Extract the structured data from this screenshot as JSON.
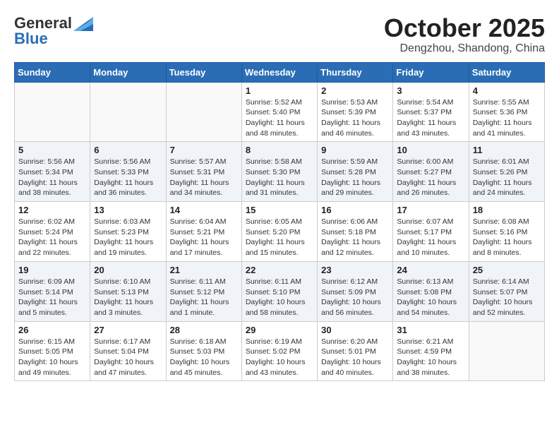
{
  "header": {
    "logo_general": "General",
    "logo_blue": "Blue",
    "month_title": "October 2025",
    "location": "Dengzhou, Shandong, China"
  },
  "weekdays": [
    "Sunday",
    "Monday",
    "Tuesday",
    "Wednesday",
    "Thursday",
    "Friday",
    "Saturday"
  ],
  "weeks": [
    [
      {
        "day": "",
        "info": ""
      },
      {
        "day": "",
        "info": ""
      },
      {
        "day": "",
        "info": ""
      },
      {
        "day": "1",
        "info": "Sunrise: 5:52 AM\nSunset: 5:40 PM\nDaylight: 11 hours\nand 48 minutes."
      },
      {
        "day": "2",
        "info": "Sunrise: 5:53 AM\nSunset: 5:39 PM\nDaylight: 11 hours\nand 46 minutes."
      },
      {
        "day": "3",
        "info": "Sunrise: 5:54 AM\nSunset: 5:37 PM\nDaylight: 11 hours\nand 43 minutes."
      },
      {
        "day": "4",
        "info": "Sunrise: 5:55 AM\nSunset: 5:36 PM\nDaylight: 11 hours\nand 41 minutes."
      }
    ],
    [
      {
        "day": "5",
        "info": "Sunrise: 5:56 AM\nSunset: 5:34 PM\nDaylight: 11 hours\nand 38 minutes."
      },
      {
        "day": "6",
        "info": "Sunrise: 5:56 AM\nSunset: 5:33 PM\nDaylight: 11 hours\nand 36 minutes."
      },
      {
        "day": "7",
        "info": "Sunrise: 5:57 AM\nSunset: 5:31 PM\nDaylight: 11 hours\nand 34 minutes."
      },
      {
        "day": "8",
        "info": "Sunrise: 5:58 AM\nSunset: 5:30 PM\nDaylight: 11 hours\nand 31 minutes."
      },
      {
        "day": "9",
        "info": "Sunrise: 5:59 AM\nSunset: 5:28 PM\nDaylight: 11 hours\nand 29 minutes."
      },
      {
        "day": "10",
        "info": "Sunrise: 6:00 AM\nSunset: 5:27 PM\nDaylight: 11 hours\nand 26 minutes."
      },
      {
        "day": "11",
        "info": "Sunrise: 6:01 AM\nSunset: 5:26 PM\nDaylight: 11 hours\nand 24 minutes."
      }
    ],
    [
      {
        "day": "12",
        "info": "Sunrise: 6:02 AM\nSunset: 5:24 PM\nDaylight: 11 hours\nand 22 minutes."
      },
      {
        "day": "13",
        "info": "Sunrise: 6:03 AM\nSunset: 5:23 PM\nDaylight: 11 hours\nand 19 minutes."
      },
      {
        "day": "14",
        "info": "Sunrise: 6:04 AM\nSunset: 5:21 PM\nDaylight: 11 hours\nand 17 minutes."
      },
      {
        "day": "15",
        "info": "Sunrise: 6:05 AM\nSunset: 5:20 PM\nDaylight: 11 hours\nand 15 minutes."
      },
      {
        "day": "16",
        "info": "Sunrise: 6:06 AM\nSunset: 5:18 PM\nDaylight: 11 hours\nand 12 minutes."
      },
      {
        "day": "17",
        "info": "Sunrise: 6:07 AM\nSunset: 5:17 PM\nDaylight: 11 hours\nand 10 minutes."
      },
      {
        "day": "18",
        "info": "Sunrise: 6:08 AM\nSunset: 5:16 PM\nDaylight: 11 hours\nand 8 minutes."
      }
    ],
    [
      {
        "day": "19",
        "info": "Sunrise: 6:09 AM\nSunset: 5:14 PM\nDaylight: 11 hours\nand 5 minutes."
      },
      {
        "day": "20",
        "info": "Sunrise: 6:10 AM\nSunset: 5:13 PM\nDaylight: 11 hours\nand 3 minutes."
      },
      {
        "day": "21",
        "info": "Sunrise: 6:11 AM\nSunset: 5:12 PM\nDaylight: 11 hours\nand 1 minute."
      },
      {
        "day": "22",
        "info": "Sunrise: 6:11 AM\nSunset: 5:10 PM\nDaylight: 10 hours\nand 58 minutes."
      },
      {
        "day": "23",
        "info": "Sunrise: 6:12 AM\nSunset: 5:09 PM\nDaylight: 10 hours\nand 56 minutes."
      },
      {
        "day": "24",
        "info": "Sunrise: 6:13 AM\nSunset: 5:08 PM\nDaylight: 10 hours\nand 54 minutes."
      },
      {
        "day": "25",
        "info": "Sunrise: 6:14 AM\nSunset: 5:07 PM\nDaylight: 10 hours\nand 52 minutes."
      }
    ],
    [
      {
        "day": "26",
        "info": "Sunrise: 6:15 AM\nSunset: 5:05 PM\nDaylight: 10 hours\nand 49 minutes."
      },
      {
        "day": "27",
        "info": "Sunrise: 6:17 AM\nSunset: 5:04 PM\nDaylight: 10 hours\nand 47 minutes."
      },
      {
        "day": "28",
        "info": "Sunrise: 6:18 AM\nSunset: 5:03 PM\nDaylight: 10 hours\nand 45 minutes."
      },
      {
        "day": "29",
        "info": "Sunrise: 6:19 AM\nSunset: 5:02 PM\nDaylight: 10 hours\nand 43 minutes."
      },
      {
        "day": "30",
        "info": "Sunrise: 6:20 AM\nSunset: 5:01 PM\nDaylight: 10 hours\nand 40 minutes."
      },
      {
        "day": "31",
        "info": "Sunrise: 6:21 AM\nSunset: 4:59 PM\nDaylight: 10 hours\nand 38 minutes."
      },
      {
        "day": "",
        "info": ""
      }
    ]
  ]
}
